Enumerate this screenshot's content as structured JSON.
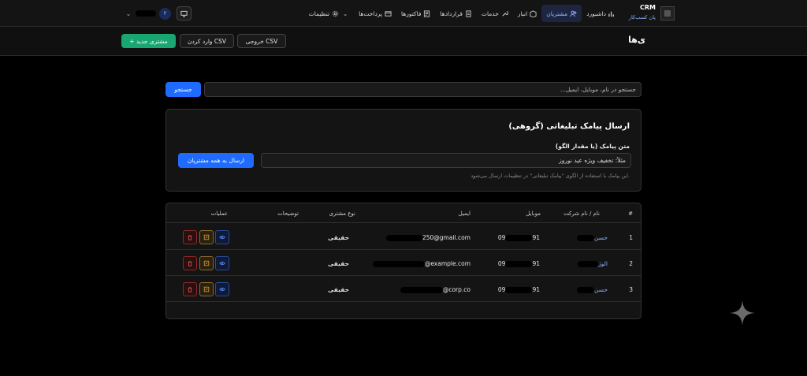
{
  "brand": {
    "title": "CRM",
    "subtitle": "پان کسب‌کار"
  },
  "nav": [
    {
      "label": "داشبورد",
      "icon": "bar-chart-icon",
      "active": false
    },
    {
      "label": "مشتریان",
      "icon": "users-icon",
      "active": true
    },
    {
      "label": "انبار",
      "icon": "box-icon",
      "active": false
    },
    {
      "label": "خدمات",
      "icon": "wrench-icon",
      "active": false
    },
    {
      "label": "قراردادها",
      "icon": "document-icon",
      "active": false
    },
    {
      "label": "فاکتورها",
      "icon": "invoice-icon",
      "active": false
    },
    {
      "label": "پرداخت‌ها",
      "icon": "card-icon",
      "active": false
    },
    {
      "label": "تنظیمات",
      "icon": "gear-icon",
      "active": false
    }
  ],
  "user": {
    "badge": "۲"
  },
  "page": {
    "title": "ی‌ها"
  },
  "actions": {
    "new_customer": "+ مشتری جدید",
    "import_csv": "وارد کردن CSV",
    "export_csv": "خروجی CSV"
  },
  "search": {
    "placeholder": "جستجو در نام، موبایل، ایمیل...",
    "button": "جستجو"
  },
  "sms": {
    "title": "ارسال پیامک تبلیغاتی (گروهی)",
    "label": "متن پیامک (یا مقدار الگو)",
    "placeholder": "مثلاً: تخفیف ویژه عید نوروز",
    "send_button": "ارسال به همه مشتریان",
    "help": "این پیامک با استفاده از الگوی \"پیامک تبلیغاتی\" در تنظیمات ارسال می‌شود."
  },
  "table": {
    "headers": {
      "index": "#",
      "name": "نام / نام شرکت",
      "mobile": "موبایل",
      "email": "ایمیل",
      "type": "نوع مشتری",
      "notes": "توضیحات",
      "actions": "عملیات"
    },
    "rows": [
      {
        "index": "1",
        "name": "حسن",
        "mobile_start": "09",
        "mobile_end": "91",
        "email": "250@gmail.com",
        "type": "حقیقی"
      },
      {
        "index": "2",
        "name": "الوژ",
        "mobile_start": "09",
        "mobile_end": "91",
        "email": "@example.com",
        "type": "حقیقی"
      },
      {
        "index": "3",
        "name": "حسن",
        "mobile_start": "09",
        "mobile_end": "91",
        "email": "@corp.co",
        "type": "حقیقی"
      }
    ]
  },
  "colors": {
    "accent": "#1f6bff",
    "success": "#18a673",
    "link": "#8ab4ff"
  }
}
